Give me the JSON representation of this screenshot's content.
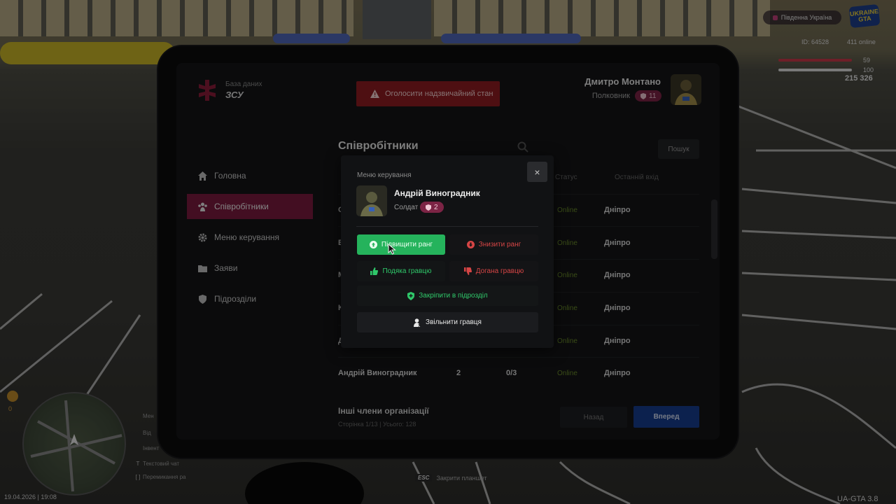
{
  "hud": {
    "server": "Південна Україна",
    "game_logo": "UKRAINE GTA",
    "player_id": "ID: 64528",
    "online": "411 online",
    "health": 59,
    "armor": 100,
    "money": "215 326",
    "date_time": "19.04.2026 | 19:08",
    "version": "UA-GTA 3.8",
    "minimap_counter": "0",
    "close_tablet_key": "ESC",
    "close_tablet_label": "Закрити планшет",
    "hints": [
      {
        "key": "",
        "label": "Мен"
      },
      {
        "key": "",
        "label": "Від"
      },
      {
        "key": "",
        "label": "Інвент"
      },
      {
        "key": "T",
        "label": "Текстовий чат"
      },
      {
        "key": "[ ]",
        "label": "Перемикання ра"
      }
    ]
  },
  "tablet": {
    "logo": {
      "subtitle": "База даних",
      "title": "ЗСУ"
    },
    "emergency_button": "Оголосити надзвичайний стан",
    "user": {
      "name": "Дмитро Монтано",
      "rank": "Полковник",
      "rank_level": "11"
    },
    "nav": [
      {
        "label": "Головна",
        "icon": "home-icon",
        "active": false
      },
      {
        "label": "Співробітники",
        "icon": "people-icon",
        "active": true
      },
      {
        "label": "Меню керування",
        "icon": "gear-icon",
        "active": false
      },
      {
        "label": "Заяви",
        "icon": "folder-icon",
        "active": false
      },
      {
        "label": "Підрозділи",
        "icon": "shield-icon",
        "active": false
      }
    ],
    "section_title": "Співробітники",
    "search_button": "Пошук",
    "columns": [
      "Статус",
      "Останній вхід"
    ],
    "rows": [
      {
        "name": "С",
        "rank": "",
        "warns": "",
        "status": "Online",
        "city": "Дніпро"
      },
      {
        "name": "В",
        "rank": "",
        "warns": "",
        "status": "Online",
        "city": "Дніпро"
      },
      {
        "name": "М",
        "rank": "",
        "warns": "",
        "status": "Online",
        "city": "Дніпро"
      },
      {
        "name": "К",
        "rank": "",
        "warns": "",
        "status": "Online",
        "city": "Дніпро"
      },
      {
        "name": "Д",
        "rank": "",
        "warns": "",
        "status": "Online",
        "city": "Дніпро"
      },
      {
        "name": "Андрій Виноградник",
        "rank": "2",
        "warns": "0/3",
        "status": "Online",
        "city": "Дніпро"
      }
    ],
    "others_title": "Інші члени організації",
    "pagination": "Сторінка 1/13 | Усього: 128",
    "back_button": "Назад",
    "next_button": "Вперед"
  },
  "modal": {
    "heading": "Меню керування",
    "close": "×",
    "employee": {
      "name": "Андрій Виноградник",
      "rank": "Солдат",
      "rank_level": "2"
    },
    "actions": {
      "promote": "Підвищити ранг",
      "demote": "Знизити ранг",
      "thank": "Подяка гравцю",
      "reprimand": "Догана гравцю",
      "assign": "Закріпити в підрозділ",
      "fire": "Звільнити гравця"
    }
  },
  "colors": {
    "accent": "#7a1b3e",
    "emergency": "#8e1d22",
    "success": "#25b35c",
    "danger": "#d64545",
    "primary": "#173c8e",
    "online": "#6a8a2a"
  }
}
